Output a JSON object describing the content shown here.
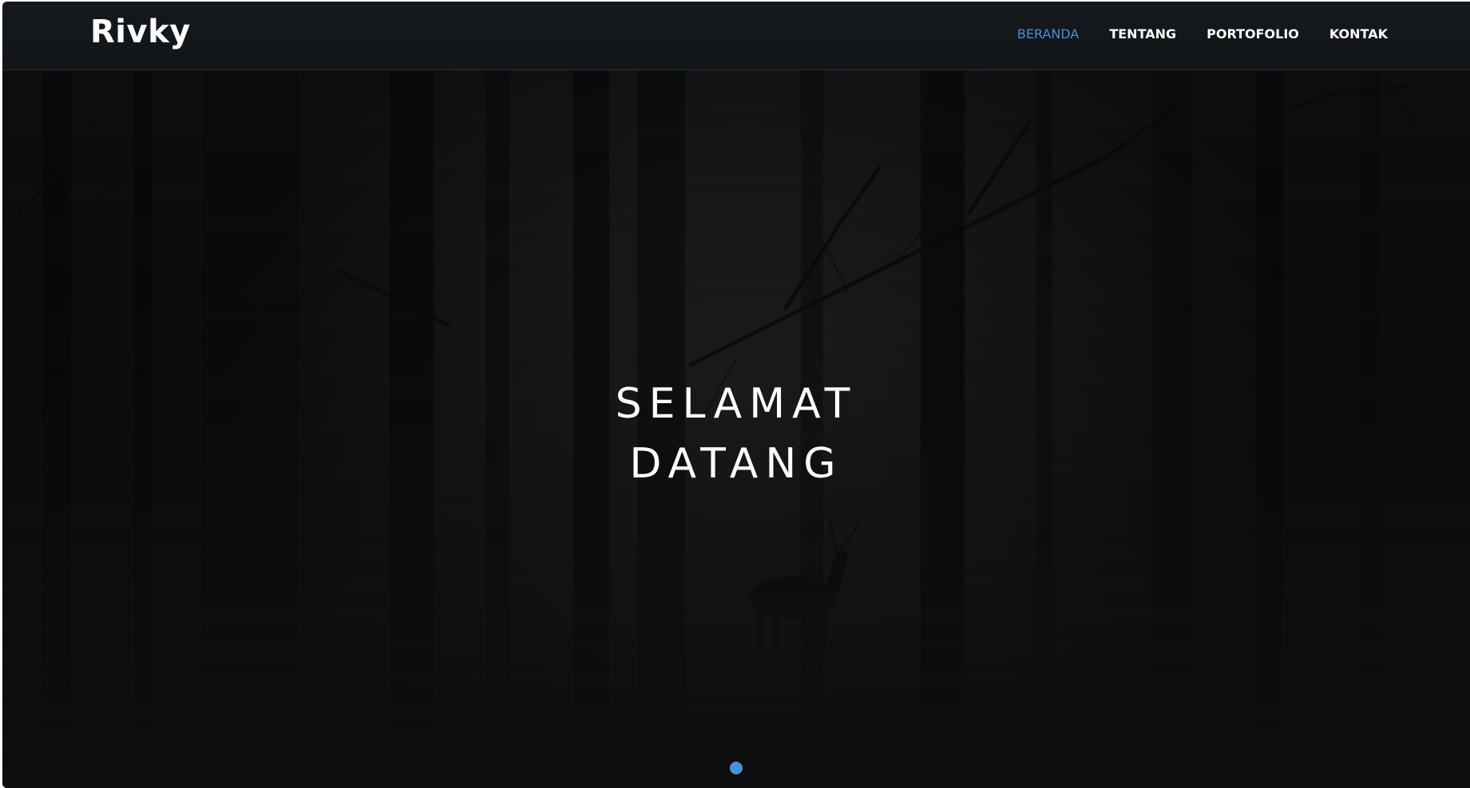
{
  "brand": "Rivky",
  "nav": [
    {
      "label": "BERANDA",
      "active": true
    },
    {
      "label": "TENTANG",
      "active": false
    },
    {
      "label": "PORTOFOLIO",
      "active": false
    },
    {
      "label": "KONTAK",
      "active": false
    }
  ],
  "hero": {
    "line1": "SELAMAT",
    "line2": "DATANG"
  },
  "colors": {
    "accent": "#4a90d9",
    "nav_text": "#ffffff",
    "navbar_bg": "#15191d",
    "hero_bg": "#121213"
  }
}
